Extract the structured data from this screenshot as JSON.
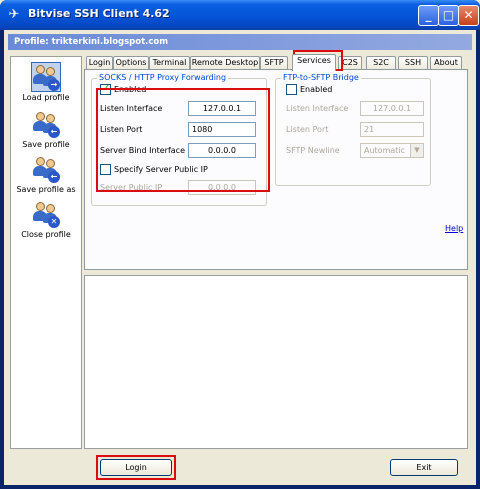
{
  "window": {
    "title": "Bitvise SSH Client 4.62"
  },
  "profile_bar": {
    "text": "Profile: trikterkini.blogspot.com"
  },
  "sidebar": {
    "items": [
      {
        "label": "Load profile",
        "icon": "load-profile-icon"
      },
      {
        "label": "Save profile",
        "icon": "save-profile-icon"
      },
      {
        "label": "Save profile as",
        "icon": "save-profile-as-icon"
      },
      {
        "label": "Close profile",
        "icon": "close-profile-icon"
      }
    ]
  },
  "tabs": [
    "Login",
    "Options",
    "Terminal",
    "Remote Desktop",
    "SFTP",
    "Services",
    "C2S",
    "S2C",
    "SSH",
    "About"
  ],
  "active_tab": "Services",
  "socks": {
    "title": "SOCKS / HTTP Proxy Forwarding",
    "enabled_label": "Enabled",
    "enabled": true,
    "listen_interface_label": "Listen Interface",
    "listen_interface": "127.0.0.1",
    "listen_port_label": "Listen Port",
    "listen_port": "1080",
    "server_bind_label": "Server Bind Interface",
    "server_bind": "0.0.0.0",
    "specify_ip_label": "Specify Server Public IP",
    "specify_ip": false,
    "server_public_ip_label": "Server Public IP",
    "server_public_ip": "0.0.0.0"
  },
  "ftp": {
    "title": "FTP-to-SFTP Bridge",
    "enabled_label": "Enabled",
    "enabled": false,
    "listen_interface_label": "Listen Interface",
    "listen_interface": "127.0.0.1",
    "listen_port_label": "Listen Port",
    "listen_port": "21",
    "newline_label": "SFTP Newline",
    "newline": "Automatic"
  },
  "help_label": "Help",
  "buttons": {
    "login": "Login",
    "exit": "Exit"
  },
  "colors": {
    "titlebar": "#0454d8",
    "highlight_box": "#dd0c0c",
    "link": "#0000ee"
  }
}
